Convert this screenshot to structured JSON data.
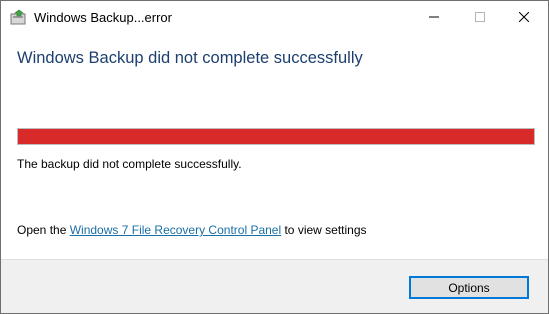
{
  "window": {
    "title": "Windows Backup...error",
    "icon": "windows-backup-icon"
  },
  "caption_buttons": {
    "minimize": "minimize-icon",
    "maximize": "maximize-icon",
    "close": "close-icon"
  },
  "main": {
    "heading": "Windows Backup did not complete successfully",
    "progress_fraction": 1.0,
    "progress_color": "#d92a2a",
    "status": "The backup did not complete successfully.",
    "open_prefix": "Open the ",
    "open_link": "Windows 7 File Recovery Control Panel",
    "open_suffix": " to view settings"
  },
  "footer": {
    "options_label": "Options"
  },
  "colors": {
    "heading": "#1d3f6d",
    "link": "#1a6fa7",
    "button_focus": "#0078d7"
  }
}
